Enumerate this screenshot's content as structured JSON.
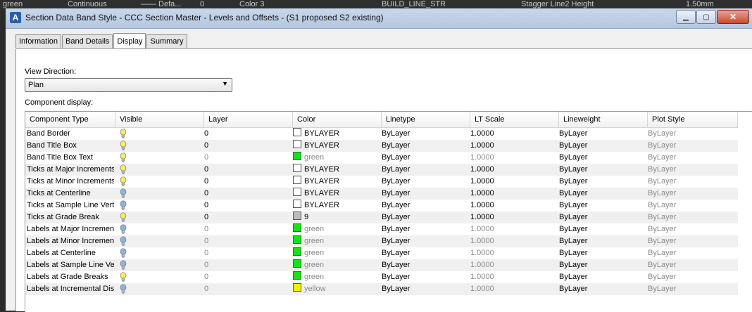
{
  "background": {
    "items": [
      "green",
      "Continuous",
      "—— Defa...",
      "0",
      "Color 3",
      "BUILD_LINE_STR",
      "Stagger Line2 Height",
      "1.50mm"
    ]
  },
  "window": {
    "title": "Section Data Band Style - CCC Section Master - Levels and Offsets - (S1 proposed S2 existing)",
    "icon_letter": "A",
    "minimize": "▁",
    "maximize": "▢",
    "close": "✕"
  },
  "tabs": [
    "Information",
    "Band Details",
    "Display",
    "Summary"
  ],
  "active_tab": "Display",
  "view_direction": {
    "label": "View Direction:",
    "value": "Plan"
  },
  "component_display_label": "Component display:",
  "columns": [
    "Component Type",
    "Visible",
    "Layer",
    "Color",
    "Linetype",
    "LT Scale",
    "Lineweight",
    "Plot Style"
  ],
  "colors": {
    "bulb_on": "#f4ea68",
    "bulb_off": "#8fb3d9"
  },
  "rows": [
    {
      "type": "Band Border",
      "visible": true,
      "layer": "0",
      "color_swatch": "#ffffff",
      "color": "BYLAYER",
      "linetype": "ByLayer",
      "lt_scale": "1.0000",
      "lineweight": "ByLayer",
      "plot_style": "ByLayer",
      "dim": false
    },
    {
      "type": "Band Title Box",
      "visible": true,
      "layer": "0",
      "color_swatch": "#ffffff",
      "color": "BYLAYER",
      "linetype": "ByLayer",
      "lt_scale": "1.0000",
      "lineweight": "ByLayer",
      "plot_style": "ByLayer",
      "dim": false
    },
    {
      "type": "Band Title Box Text",
      "visible": true,
      "layer": "0",
      "color_swatch": "#17e317",
      "color": "green",
      "linetype": "ByLayer",
      "lt_scale": "1.0000",
      "lineweight": "ByLayer",
      "plot_style": "ByLayer",
      "dim": true
    },
    {
      "type": "Ticks at Major Increments",
      "visible": true,
      "layer": "0",
      "color_swatch": "#ffffff",
      "color": "BYLAYER",
      "linetype": "ByLayer",
      "lt_scale": "1.0000",
      "lineweight": "ByLayer",
      "plot_style": "ByLayer",
      "dim": false
    },
    {
      "type": "Ticks at Minor Increments",
      "visible": true,
      "layer": "0",
      "color_swatch": "#ffffff",
      "color": "BYLAYER",
      "linetype": "ByLayer",
      "lt_scale": "1.0000",
      "lineweight": "ByLayer",
      "plot_style": "ByLayer",
      "dim": false
    },
    {
      "type": "Ticks at Centerline",
      "visible": false,
      "layer": "0",
      "color_swatch": "#ffffff",
      "color": "BYLAYER",
      "linetype": "ByLayer",
      "lt_scale": "1.0000",
      "lineweight": "ByLayer",
      "plot_style": "ByLayer",
      "dim": false
    },
    {
      "type": "Ticks at Sample Line Verte",
      "visible": false,
      "layer": "0",
      "color_swatch": "#ffffff",
      "color": "BYLAYER",
      "linetype": "ByLayer",
      "lt_scale": "1.0000",
      "lineweight": "ByLayer",
      "plot_style": "ByLayer",
      "dim": false
    },
    {
      "type": "Ticks at Grade Break",
      "visible": true,
      "layer": "0",
      "color_swatch": "#bcbcbc",
      "color": "9",
      "linetype": "ByLayer",
      "lt_scale": "1.0000",
      "lineweight": "ByLayer",
      "plot_style": "ByLayer",
      "dim": false
    },
    {
      "type": "Labels at Major Increment",
      "visible": false,
      "layer": "0",
      "color_swatch": "#17e317",
      "color": "green",
      "linetype": "ByLayer",
      "lt_scale": "1.0000",
      "lineweight": "ByLayer",
      "plot_style": "ByLayer",
      "dim": true
    },
    {
      "type": "Labels at Minor Increment",
      "visible": false,
      "layer": "0",
      "color_swatch": "#17e317",
      "color": "green",
      "linetype": "ByLayer",
      "lt_scale": "1.0000",
      "lineweight": "ByLayer",
      "plot_style": "ByLayer",
      "dim": true
    },
    {
      "type": "Labels at Centerline",
      "visible": false,
      "layer": "0",
      "color_swatch": "#17e317",
      "color": "green",
      "linetype": "ByLayer",
      "lt_scale": "1.0000",
      "lineweight": "ByLayer",
      "plot_style": "ByLayer",
      "dim": true
    },
    {
      "type": "Labels at Sample Line Vert",
      "visible": false,
      "layer": "0",
      "color_swatch": "#17e317",
      "color": "green",
      "linetype": "ByLayer",
      "lt_scale": "1.0000",
      "lineweight": "ByLayer",
      "plot_style": "ByLayer",
      "dim": true
    },
    {
      "type": "Labels at Grade Breaks",
      "visible": true,
      "layer": "0",
      "color_swatch": "#17e317",
      "color": "green",
      "linetype": "ByLayer",
      "lt_scale": "1.0000",
      "lineweight": "ByLayer",
      "plot_style": "ByLayer",
      "dim": true
    },
    {
      "type": "Labels at Incremental Dist",
      "visible": false,
      "layer": "0",
      "color_swatch": "#f2f200",
      "color": "yellow",
      "linetype": "ByLayer",
      "lt_scale": "1.0000",
      "lineweight": "ByLayer",
      "plot_style": "ByLayer",
      "dim": true
    }
  ]
}
